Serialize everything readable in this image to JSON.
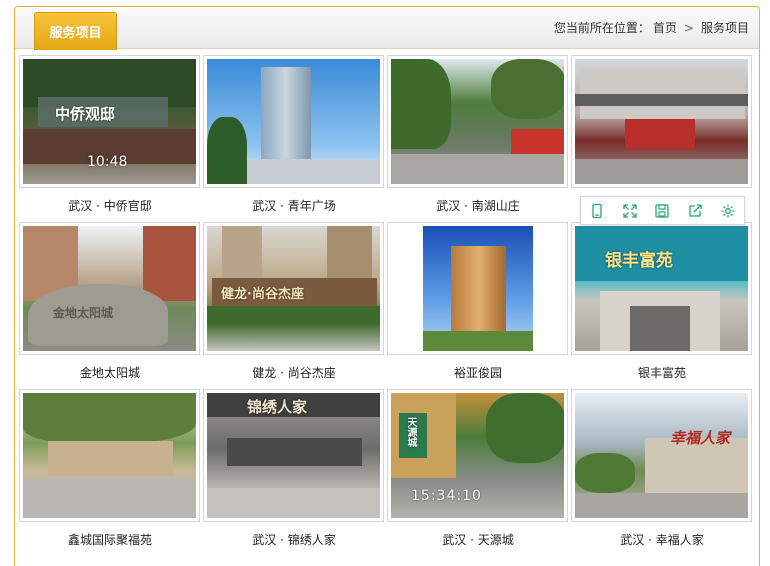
{
  "header": {
    "tab_label": "服务项目",
    "breadcrumb": {
      "prefix": "您当前所在位置：",
      "home": "首页",
      "separator": ">",
      "current": "服务项目"
    }
  },
  "projects": [
    {
      "caption": "武汉 · 中侨官邸",
      "photo_text": "中侨观邸",
      "photo_time": "10:48"
    },
    {
      "caption": "武汉 · 青年广场"
    },
    {
      "caption": "武汉 · 南湖山庄"
    },
    {
      "caption": ""
    },
    {
      "caption": "金地太阳城",
      "photo_text": "金地太阳城"
    },
    {
      "caption": "健龙 · 尚谷杰座",
      "photo_text": "健龙·尚谷杰座"
    },
    {
      "caption": "裕亚俊园"
    },
    {
      "caption": "银丰富苑",
      "photo_text": "银丰富苑"
    },
    {
      "caption": "鑫城国际聚福苑"
    },
    {
      "caption": "武汉 · 锦绣人家",
      "photo_text": "锦绣人家"
    },
    {
      "caption": "武汉 · 天源城",
      "photo_text": "天源城",
      "photo_time": "15:34:10"
    },
    {
      "caption": "武汉 · 幸福人家",
      "photo_text": "幸福人家"
    }
  ],
  "image_toolbar": {
    "icons": [
      "phone-icon",
      "expand-icon",
      "save-icon",
      "share-icon",
      "settings-icon"
    ]
  },
  "colors": {
    "accent": "#e9ad1f",
    "border": "#e3b23c"
  }
}
